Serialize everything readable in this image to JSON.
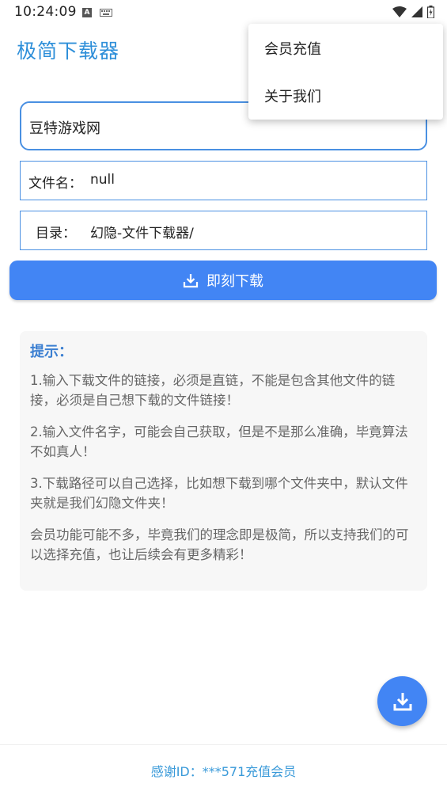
{
  "status_bar": {
    "time": "10:24:09",
    "a_badge": "A"
  },
  "app": {
    "title": "极简下载器"
  },
  "form": {
    "url_value": "豆特游戏网",
    "filename_label": "文件名：",
    "filename_value": "null",
    "dir_label": "目录：",
    "dir_value": "幻隐-文件下载器/"
  },
  "download_button": {
    "label": "即刻下载"
  },
  "tips": {
    "title": "提示：",
    "paragraphs": [
      "1.输入下载文件的链接，必须是直链，不能是包含其他文件的链接，必须是自己想下载的文件链接！",
      "2.输入文件名字，可能会自己获取，但是不是那么准确，毕竟算法不如真人！",
      "3.下载路径可以自己选择，比如想下载到哪个文件夹中，默认文件夹就是我们幻隐文件夹！",
      "会员功能可能不多，毕竟我们的理念即是极简，所以支持我们的可以选择充值，也让后续会有更多精彩！"
    ]
  },
  "footer": {
    "text": "感谢ID：***571充值会员"
  },
  "menu": {
    "items": [
      "会员充值",
      "关于我们"
    ]
  },
  "colors": {
    "accent": "#4285f4",
    "title": "#2e8fd9",
    "field_border": "#4a90e2",
    "tips_title": "#3b7fd1",
    "footer_text": "#3a9ad9"
  }
}
